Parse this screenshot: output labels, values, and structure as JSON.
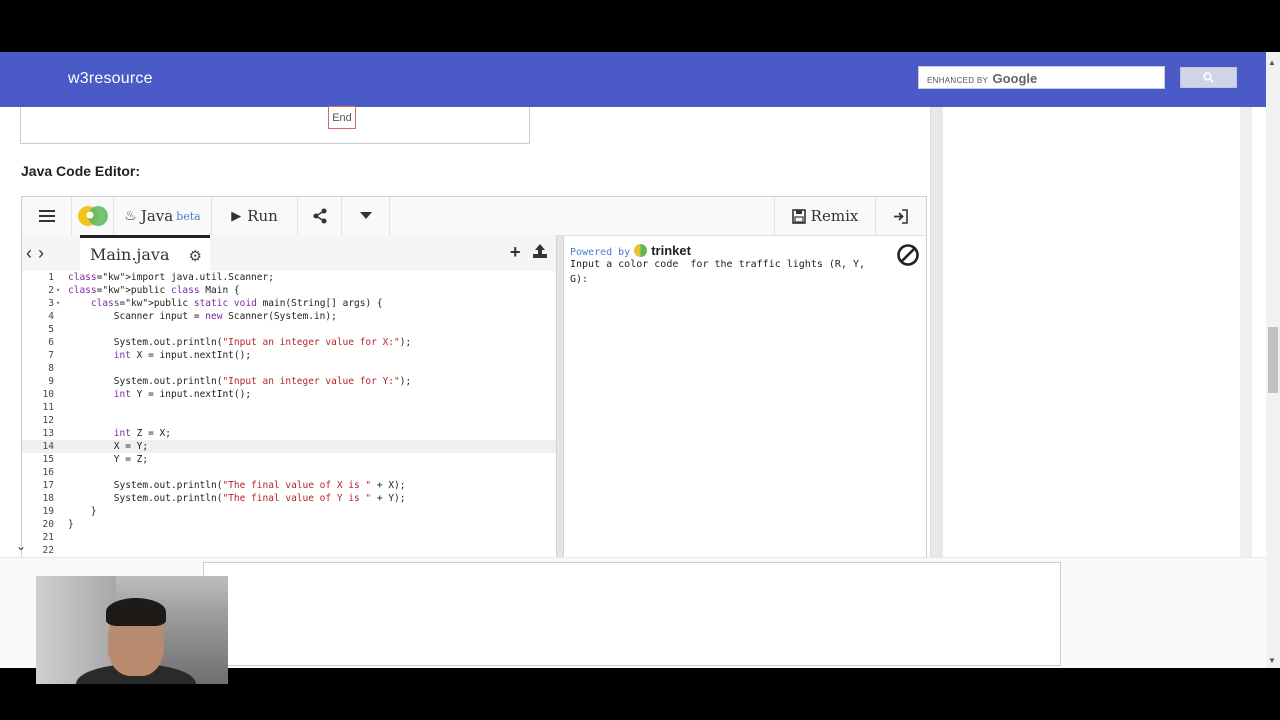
{
  "header": {
    "brand": "w3resource",
    "search": {
      "placeholder_prefix": "ENHANCED BY",
      "placeholder_brand": "Google",
      "button_icon": "search-icon"
    }
  },
  "flowchart": {
    "end_label": "End"
  },
  "section": {
    "heading": "Java Code Editor:"
  },
  "editor": {
    "toolbar": {
      "menu_icon": "hamburger-icon",
      "language": "Java",
      "language_badge": "beta",
      "run_label": "Run",
      "remix_label": "Remix",
      "icons": [
        "trinket-logo-icon",
        "java-icon",
        "play-icon",
        "share-icon",
        "chevron-down-icon",
        "remix-file-icon",
        "login-icon"
      ]
    },
    "file_tab": {
      "name": "Main.java",
      "icons": [
        "gear-icon",
        "add-icon",
        "upload-icon",
        "back-arrow-icon",
        "forward-arrow-icon"
      ]
    },
    "code_lines": [
      {
        "n": "1",
        "t": "import java.util.Scanner;"
      },
      {
        "n": "2",
        "t": "public class Main {"
      },
      {
        "n": "3",
        "t": "    public static void main(String[] args) {"
      },
      {
        "n": "4",
        "t": "        Scanner input = new Scanner(System.in);"
      },
      {
        "n": "5",
        "t": ""
      },
      {
        "n": "6",
        "t": "        System.out.println(\"Input an integer value for X:\");"
      },
      {
        "n": "7",
        "t": "        int X = input.nextInt();"
      },
      {
        "n": "8",
        "t": ""
      },
      {
        "n": "9",
        "t": "        System.out.println(\"Input an integer value for Y:\");"
      },
      {
        "n": "10",
        "t": "        int Y = input.nextInt();"
      },
      {
        "n": "11",
        "t": ""
      },
      {
        "n": "12",
        "t": ""
      },
      {
        "n": "13",
        "t": "        int Z = X;"
      },
      {
        "n": "14",
        "t": "        X = Y;"
      },
      {
        "n": "15",
        "t": "        Y = Z;"
      },
      {
        "n": "16",
        "t": ""
      },
      {
        "n": "17",
        "t": "        System.out.println(\"The final value of X is \" + X);"
      },
      {
        "n": "18",
        "t": "        System.out.println(\"The final value of Y is \" + Y);"
      },
      {
        "n": "19",
        "t": "    }"
      },
      {
        "n": "20",
        "t": "}"
      },
      {
        "n": "21",
        "t": ""
      },
      {
        "n": "22",
        "t": ""
      }
    ],
    "output": {
      "powered_by": "Powered by",
      "brand": "trinket",
      "text": "Input a color code  for the traffic lights (R, Y,\nG):"
    }
  },
  "colors": {
    "header_bg": "#4a5bc7",
    "keyword": "#7a2aa0",
    "string": "#b3262a",
    "link": "#4a7bd0"
  }
}
